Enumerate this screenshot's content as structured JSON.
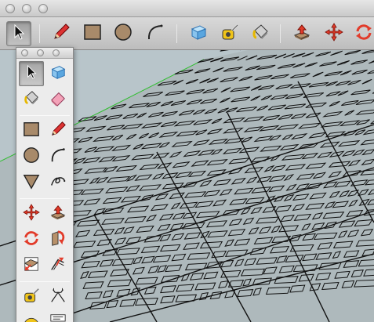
{
  "window": {
    "traffic_lights": [
      "close-light",
      "minimize-light",
      "zoom-light"
    ]
  },
  "toolbar": {
    "buttons": [
      {
        "icon": "select-arrow-icon",
        "active": true
      },
      {
        "icon": "pencil-line-icon"
      },
      {
        "icon": "rectangle-icon"
      },
      {
        "icon": "circle-icon"
      },
      {
        "icon": "arc-icon"
      },
      {
        "icon": "make-component-icon"
      },
      {
        "icon": "tape-measure-icon"
      },
      {
        "icon": "paint-bucket-icon"
      },
      {
        "icon": "push-pull-icon"
      },
      {
        "icon": "move-icon"
      },
      {
        "icon": "rotate-icon"
      }
    ]
  },
  "palette": {
    "title_lights": [
      "close-light",
      "minimize-light",
      "zoom-light"
    ],
    "buttons": [
      {
        "icon": "select-arrow-icon",
        "active": true
      },
      {
        "icon": "make-component-icon"
      },
      {
        "icon": "paint-bucket-icon"
      },
      {
        "icon": "eraser-icon"
      },
      {
        "icon": "rectangle-icon"
      },
      {
        "icon": "pencil-line-icon"
      },
      {
        "icon": "circle-icon"
      },
      {
        "icon": "arc-icon"
      },
      {
        "icon": "polygon-icon"
      },
      {
        "icon": "freehand-icon"
      },
      {
        "icon": "move-icon"
      },
      {
        "icon": "push-pull-icon"
      },
      {
        "icon": "rotate-icon"
      },
      {
        "icon": "follow-me-icon"
      },
      {
        "icon": "scale-icon"
      },
      {
        "icon": "offset-icon"
      },
      {
        "icon": "tape-measure-icon"
      },
      {
        "icon": "dimension-icon"
      },
      {
        "icon": "protractor-icon"
      },
      {
        "icon": "text-icon"
      }
    ]
  },
  "colors": {
    "viewport_bg": "#b8c5ca",
    "ground_edge": "#2fbf2f",
    "linework": "#111111",
    "face_fill": "#a9b3b6"
  }
}
